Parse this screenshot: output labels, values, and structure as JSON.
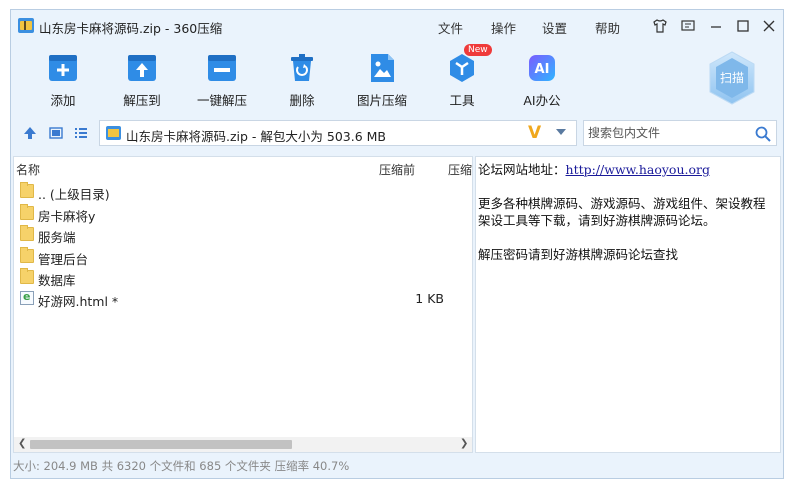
{
  "window": {
    "title": "山东房卡麻将源码.zip - 360压缩"
  },
  "menu": {
    "items": [
      "文件",
      "操作",
      "设置",
      "帮助"
    ]
  },
  "toolbar": {
    "tools": [
      {
        "label": "添加",
        "icon": "add-icon"
      },
      {
        "label": "解压到",
        "icon": "extract-to-icon"
      },
      {
        "label": "一键解压",
        "icon": "one-click-extract-icon"
      },
      {
        "label": "删除",
        "icon": "trash-icon"
      },
      {
        "label": "图片压缩",
        "icon": "image-compress-icon"
      },
      {
        "label": "工具",
        "icon": "tools-icon",
        "badge": "New"
      },
      {
        "label": "AI办公",
        "icon": "ai-office-icon",
        "glyph": "AI"
      }
    ],
    "scan_label": "扫描"
  },
  "address": {
    "path": "山东房卡麻将源码.zip - 解包大小为 503.6 MB",
    "logo": "V",
    "search_placeholder": "搜索包内文件"
  },
  "filelist": {
    "columns": [
      "名称",
      "压缩前",
      "压缩"
    ],
    "rows": [
      {
        "name": ".. (上级目录)",
        "type": "folder",
        "size": ""
      },
      {
        "name": "房卡麻将y",
        "type": "folder",
        "size": ""
      },
      {
        "name": "服务端",
        "type": "folder",
        "size": ""
      },
      {
        "name": "管理后台",
        "type": "folder",
        "size": ""
      },
      {
        "name": "数据库",
        "type": "folder",
        "size": ""
      },
      {
        "name": "好游网.html *",
        "type": "html",
        "size": "1 KB"
      }
    ]
  },
  "info": {
    "forum_label": "论坛网站地址：",
    "forum_url": "http://www.haoyou.org",
    "line2": "更多各种棋牌源码、游戏源码、游戏组件、架设教程",
    "line3": "架设工具等下载，请到好游棋牌源码论坛。",
    "line4": "解压密码请到好游棋牌源码论坛查找"
  },
  "status": {
    "text": "大小: 204.9 MB 共 6320 个文件和 685 个文件夹 压缩率 40.7%"
  },
  "colors": {
    "accent": "#2f8ce6",
    "window_bg": "#eaf3fc",
    "folder": "#f6d26a",
    "new_badge": "#ef3a3a",
    "ai_gradient_start": "#7a5cff",
    "ai_gradient_end": "#2fb5ff"
  }
}
